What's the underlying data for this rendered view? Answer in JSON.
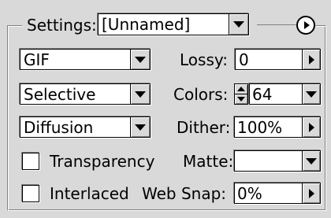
{
  "settings": {
    "label": "Settings:",
    "value": "[Unnamed]"
  },
  "format": {
    "value": "GIF"
  },
  "palette": {
    "value": "Selective"
  },
  "dither_algo": {
    "value": "Diffusion"
  },
  "lossy": {
    "label": "Lossy:",
    "value": "0"
  },
  "colors": {
    "label": "Colors:",
    "value": "64"
  },
  "dither": {
    "label": "Dither:",
    "value": "100%"
  },
  "matte": {
    "label": "Matte:",
    "value": ""
  },
  "web_snap": {
    "label": "Web Snap:",
    "value": "0%"
  },
  "transparency": {
    "label": "Transparency",
    "checked": false
  },
  "interlaced": {
    "label": "Interlaced",
    "checked": false
  },
  "icons": {
    "dropdown": "chevron-down-icon",
    "slider": "chevron-right-icon",
    "menu": "circle-arrow-icon",
    "stepper": "stepper-icon"
  }
}
